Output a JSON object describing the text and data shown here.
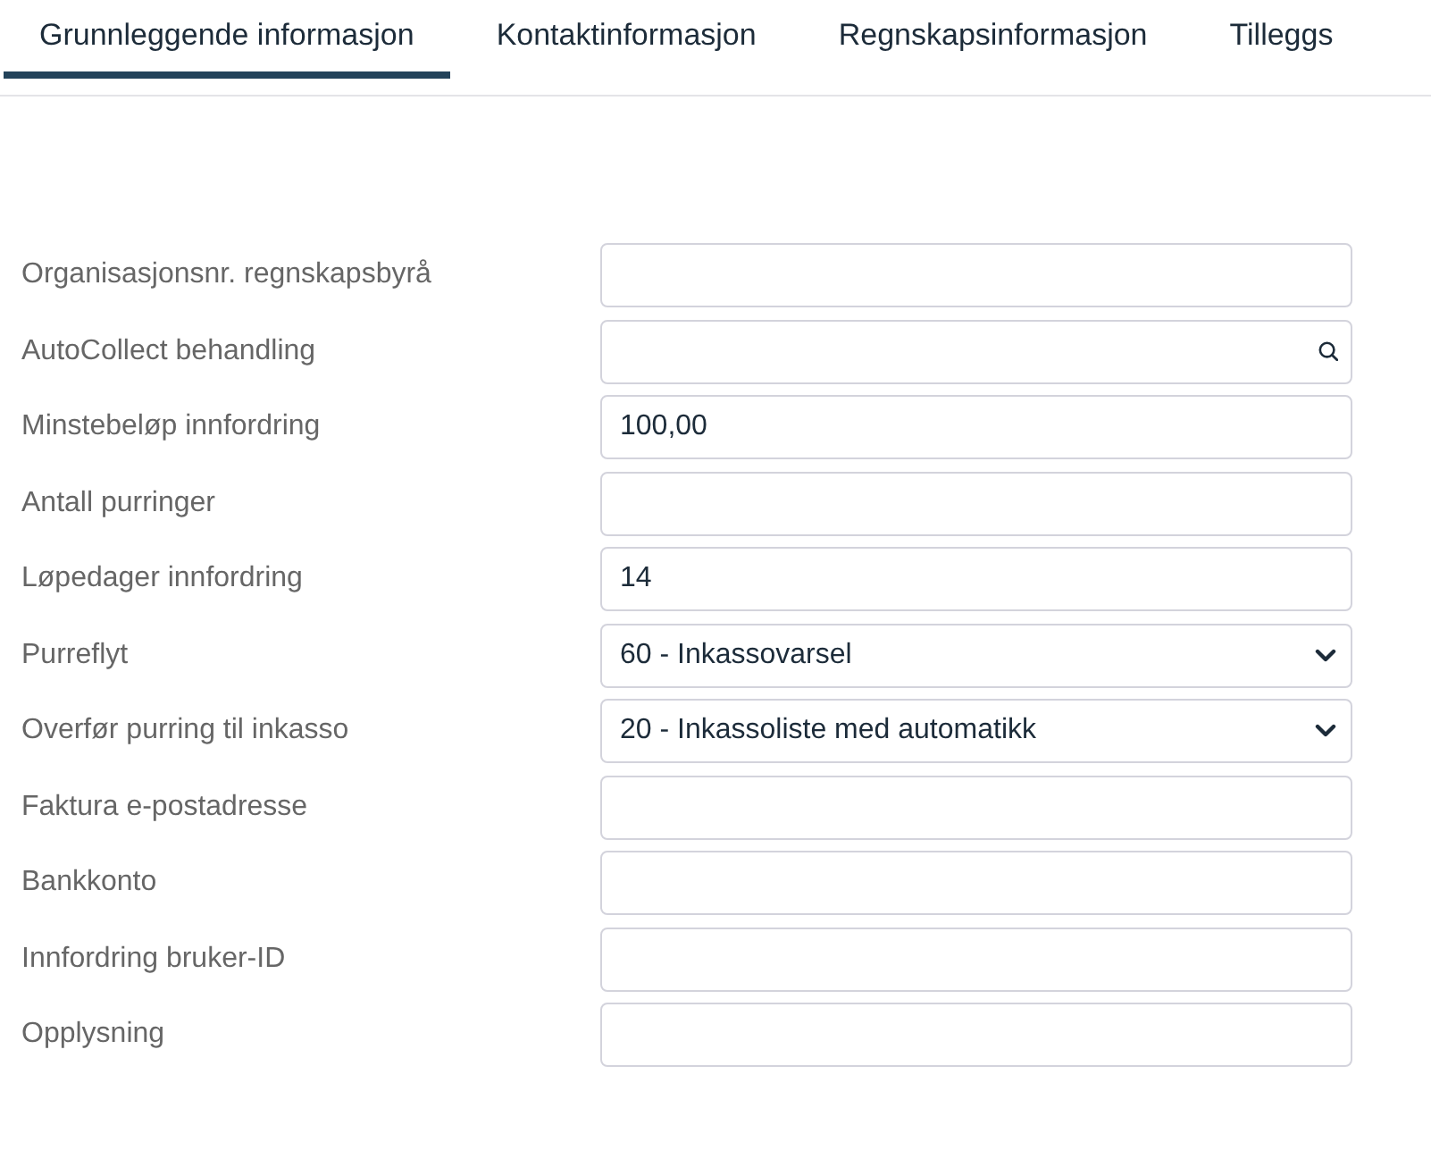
{
  "tabs": [
    {
      "label": "Grunnleggende informasjon",
      "selected": true
    },
    {
      "label": "Kontaktinformasjon",
      "selected": false
    },
    {
      "label": "Regnskapsinformasjon",
      "selected": false
    },
    {
      "label": "Tilleggs",
      "selected": false
    }
  ],
  "form": {
    "fields": [
      {
        "label": "Organisasjonsnr. regnskapsbyrå",
        "kind": "text"
      },
      {
        "label": "AutoCollect behandling",
        "kind": "search"
      },
      {
        "label": "Minstebeløp innfordring",
        "kind": "text",
        "value": "100,00"
      },
      {
        "label": "Antall purringer",
        "kind": "text"
      },
      {
        "label": "Løpedager innfordring",
        "kind": "text",
        "value": "14"
      },
      {
        "label": "Purreflyt",
        "kind": "select",
        "value": "60 - Inkassovarsel"
      },
      {
        "label": "Overfør purring til inkasso",
        "kind": "select",
        "value": "20 - Inkassoliste med automatikk"
      },
      {
        "label": "Faktura e-postadresse",
        "kind": "text"
      },
      {
        "label": "Bankkonto",
        "kind": "text"
      },
      {
        "label": "Innfordring bruker-ID",
        "kind": "text"
      },
      {
        "label": "Opplysning",
        "kind": "text"
      }
    ]
  }
}
